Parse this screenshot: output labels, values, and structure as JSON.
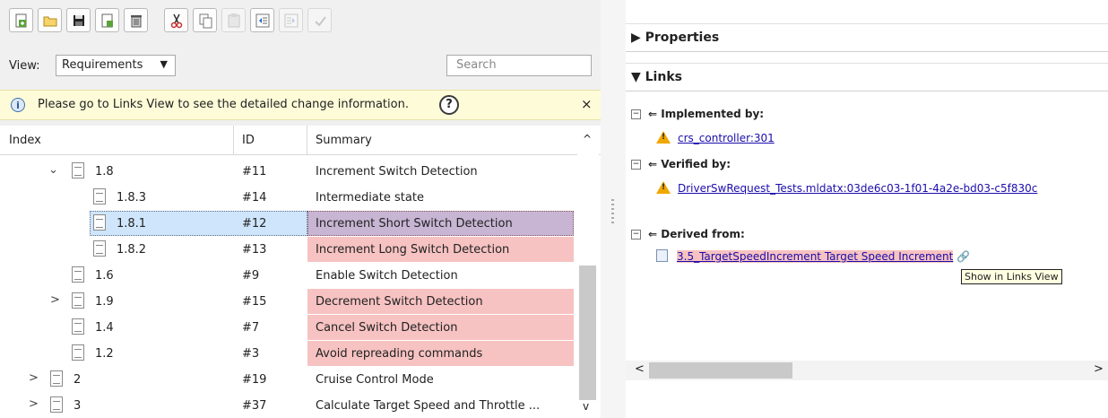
{
  "toolbar": {
    "buttons": [
      {
        "icon": "add-requirement-icon"
      },
      {
        "icon": "open-folder-icon"
      },
      {
        "icon": "save-icon"
      },
      {
        "icon": "add-child-icon"
      },
      {
        "icon": "delete-icon"
      },
      {
        "icon": "cut-icon"
      },
      {
        "icon": "copy-icon"
      },
      {
        "icon": "paste-icon"
      },
      {
        "icon": "outdent-icon"
      },
      {
        "icon": "indent-icon"
      },
      {
        "icon": "link-icon"
      }
    ]
  },
  "view": {
    "label": "View:",
    "selected": "Requirements",
    "search_placeholder": "Search"
  },
  "info_bar": {
    "text": "Please go to Links View to see the detailed change information.",
    "help": "?",
    "close": "×"
  },
  "table": {
    "headers": {
      "index": "Index",
      "id": "ID",
      "summary": "Summary"
    },
    "rows": [
      {
        "index": "1.8",
        "id": "#11",
        "summary": "Increment Switch Detection",
        "state": "normal",
        "expander": "expanded"
      },
      {
        "index": "1.8.3",
        "id": "#14",
        "summary": "Intermediate state",
        "state": "normal",
        "expander": "none"
      },
      {
        "index": "1.8.1",
        "id": "#12",
        "summary": "Increment Short Switch Detection",
        "state": "selected",
        "expander": "none"
      },
      {
        "index": "1.8.2",
        "id": "#13",
        "summary": "Increment Long Switch Detection",
        "state": "changed",
        "expander": "none"
      },
      {
        "index": "1.6",
        "id": "#9",
        "summary": "Enable Switch Detection",
        "state": "normal",
        "expander": "none"
      },
      {
        "index": "1.9",
        "id": "#15",
        "summary": "Decrement Switch Detection",
        "state": "changed",
        "expander": "collapsed"
      },
      {
        "index": "1.4",
        "id": "#7",
        "summary": "Cancel Switch Detection",
        "state": "changed",
        "expander": "none"
      },
      {
        "index": "1.2",
        "id": "#3",
        "summary": "Avoid repreading commands",
        "state": "changed",
        "expander": "none"
      },
      {
        "index": "2",
        "id": "#19",
        "summary": "Cruise Control Mode",
        "state": "normal",
        "expander": "collapsed"
      },
      {
        "index": "3",
        "id": "#37",
        "summary": "Calculate Target Speed and Throttle ...",
        "state": "normal",
        "expander": "collapsed"
      }
    ]
  },
  "properties": {
    "title": "Properties"
  },
  "links": {
    "title": "Links",
    "implemented_by": {
      "label": "Implemented by:",
      "item": "crs_controller:301"
    },
    "verified_by": {
      "label": "Verified by:",
      "item": "DriverSwRequest_Tests.mldatx:03de6c03-1f01-4a2e-bd03-c5f830c"
    },
    "derived_from": {
      "label": "Derived from:",
      "item": "3.5_TargetSpeedIncrement Target Speed Increment"
    },
    "tooltip": "Show in Links View"
  },
  "colors": {
    "changed": "#f7c2c2",
    "selected": "#cfe5fb",
    "selected_summary": "#c7b5d3",
    "info_bar": "#fefbd8"
  }
}
